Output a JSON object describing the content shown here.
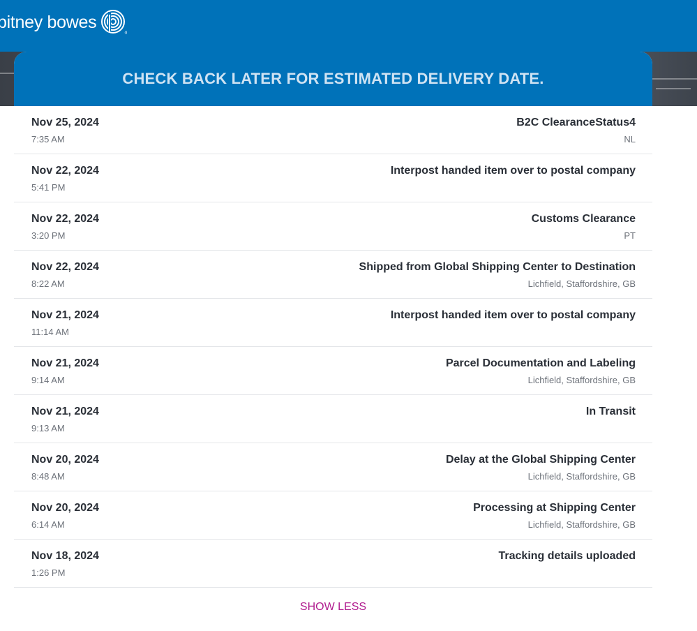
{
  "brand": {
    "name": "pitney bowes"
  },
  "banner": {
    "message": "CHECK BACK LATER FOR ESTIMATED DELIVERY DATE."
  },
  "events": [
    {
      "date": "Nov 25, 2024",
      "time": "7:35 AM",
      "status": "B2C ClearanceStatus4",
      "location": "NL"
    },
    {
      "date": "Nov 22, 2024",
      "time": "5:41 PM",
      "status": "Interpost handed item over to postal company",
      "location": ""
    },
    {
      "date": "Nov 22, 2024",
      "time": "3:20 PM",
      "status": "Customs Clearance",
      "location": "PT"
    },
    {
      "date": "Nov 22, 2024",
      "time": "8:22 AM",
      "status": "Shipped from Global Shipping Center to Destination",
      "location": "Lichfield, Staffordshire, GB"
    },
    {
      "date": "Nov 21, 2024",
      "time": "11:14 AM",
      "status": "Interpost handed item over to postal company",
      "location": ""
    },
    {
      "date": "Nov 21, 2024",
      "time": "9:14 AM",
      "status": "Parcel Documentation and Labeling",
      "location": "Lichfield, Staffordshire, GB"
    },
    {
      "date": "Nov 21, 2024",
      "time": "9:13 AM",
      "status": "In Transit",
      "location": ""
    },
    {
      "date": "Nov 20, 2024",
      "time": "8:48 AM",
      "status": "Delay at the Global Shipping Center",
      "location": "Lichfield, Staffordshire, GB"
    },
    {
      "date": "Nov 20, 2024",
      "time": "6:14 AM",
      "status": "Processing at Shipping Center",
      "location": "Lichfield, Staffordshire, GB"
    },
    {
      "date": "Nov 18, 2024",
      "time": "1:26 PM",
      "status": "Tracking details uploaded",
      "location": ""
    }
  ],
  "actions": {
    "show_less_label": "SHOW LESS"
  },
  "colors": {
    "brand_blue": "#0072b9",
    "link_magenta": "#b01b8e"
  },
  "icons": {
    "logo_mark": "pitney-bowes-circle-logo-icon"
  }
}
